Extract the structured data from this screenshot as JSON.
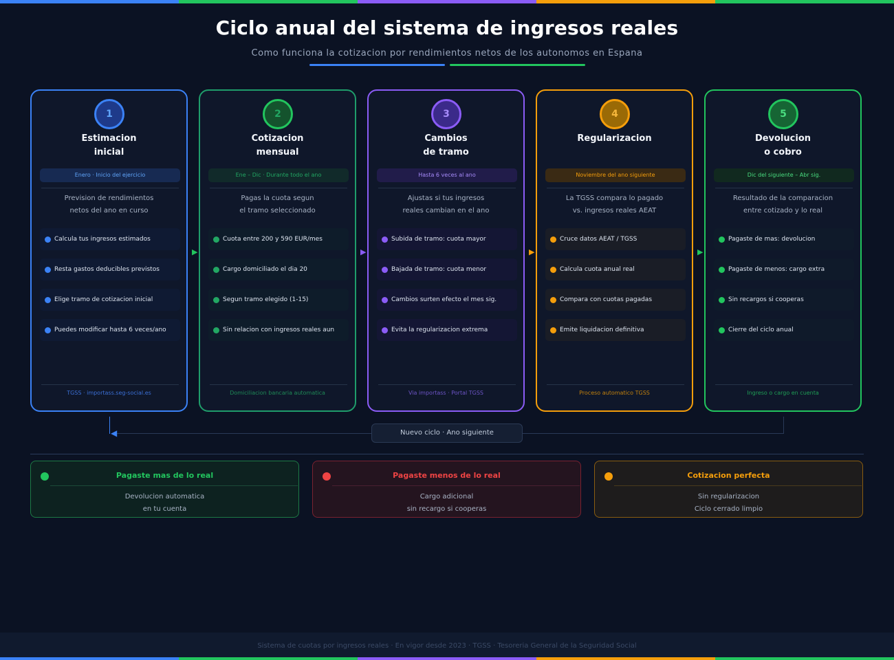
{
  "title": "Ciclo anual del sistema de ingresos reales",
  "subtitle": "Como funciona la cotizacion por rendimientos netos de los autonomos en Espana",
  "colors": {
    "background": "#0b1223",
    "blue": "#3b82f6",
    "green": "#22c55e",
    "purple": "#8b5cf6",
    "orange": "#f59e0b",
    "red": "#ef4444"
  },
  "steps": [
    {
      "number": "1",
      "title_line1": "Estimacion",
      "title_line2": "inicial",
      "period": "Enero · Inicio del ejercicio",
      "desc_line1": "Prevision de rendimientos",
      "desc_line2": "netos del ano en curso",
      "items": [
        "Calcula tus ingresos estimados",
        "Resta gastos deducibles previstos",
        "Elige tramo de cotizacion inicial",
        "Puedes modificar hasta 6 veces/ano"
      ],
      "footer": "TGSS · importass.seg-social.es"
    },
    {
      "number": "2",
      "title_line1": "Cotizacion",
      "title_line2": "mensual",
      "period": "Ene – Dic · Durante todo el ano",
      "desc_line1": "Pagas la cuota segun",
      "desc_line2": "el tramo seleccionado",
      "items": [
        "Cuota entre 200 y 590 EUR/mes",
        "Cargo domiciliado el dia 20",
        "Segun tramo elegido (1-15)",
        "Sin relacion con ingresos reales aun"
      ],
      "footer": "Domiciliacion bancaria automatica"
    },
    {
      "number": "3",
      "title_line1": "Cambios",
      "title_line2": "de tramo",
      "period": "Hasta 6 veces al ano",
      "desc_line1": "Ajustas si tus ingresos",
      "desc_line2": "reales cambian en el ano",
      "items": [
        "Subida de tramo: cuota mayor",
        "Bajada de tramo: cuota menor",
        "Cambios surten efecto el mes sig.",
        "Evita la regularizacion extrema"
      ],
      "footer": "Via importass · Portal TGSS"
    },
    {
      "number": "4",
      "title_line1": "Regularizacion",
      "title_line2": "",
      "period": "Noviembre del ano siguiente",
      "desc_line1": "La TGSS compara lo pagado",
      "desc_line2": "vs. ingresos reales AEAT",
      "items": [
        "Cruce datos AEAT / TGSS",
        "Calcula cuota anual real",
        "Compara con cuotas pagadas",
        "Emite liquidacion definitiva"
      ],
      "footer": "Proceso automatico TGSS"
    },
    {
      "number": "5",
      "title_line1": "Devolucion",
      "title_line2": "o cobro",
      "period": "Dic del siguiente – Abr sig.",
      "desc_line1": "Resultado de la comparacion",
      "desc_line2": "entre cotizado y lo real",
      "items": [
        "Pagaste de mas: devolucion",
        "Pagaste de menos: cargo extra",
        "Sin recargos si cooperas",
        "Cierre del ciclo anual"
      ],
      "footer": "Ingreso o cargo en cuenta"
    }
  ],
  "loop_label": "Nuevo ciclo · Ano siguiente",
  "results": [
    {
      "title": "Pagaste mas de lo real",
      "line1": "Devolucion automatica",
      "line2": "en tu cuenta"
    },
    {
      "title": "Pagaste menos de lo real",
      "line1": "Cargo adicional",
      "line2": "sin recargo si cooperas"
    },
    {
      "title": "Cotizacion perfecta",
      "line1": "Sin regularizacion",
      "line2": "Ciclo cerrado limpio"
    }
  ],
  "footer": "Sistema de cuotas por ingresos reales · En vigor desde 2023 · TGSS · Tesoreria General de la Seguridad Social"
}
